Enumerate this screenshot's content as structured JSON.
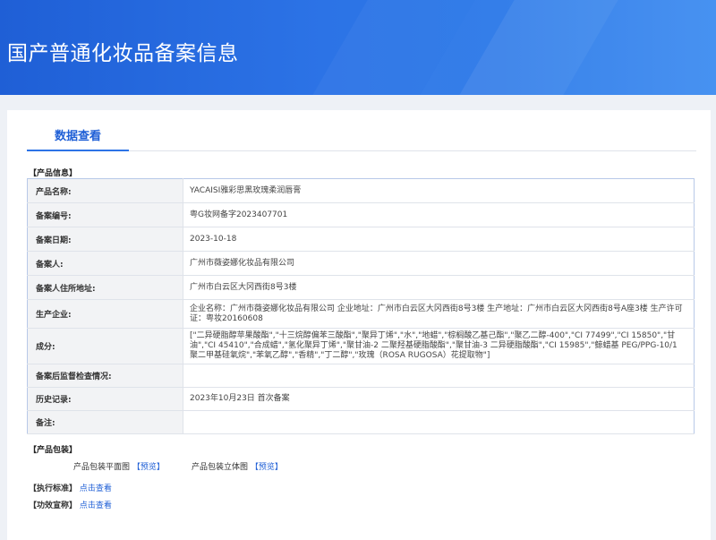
{
  "banner": {
    "title": "国产普通化妆品备案信息"
  },
  "tab": {
    "label": "数据查看"
  },
  "product_info": {
    "section": "【产品信息】",
    "rows": [
      {
        "key": "产品名称:",
        "value": "YACAISI雅彩思黑玫瑰柔润唇膏"
      },
      {
        "key": "备案编号:",
        "value": "粤G妆网备字2023407701"
      },
      {
        "key": "备案日期:",
        "value": "2023-10-18"
      },
      {
        "key": "备案人:",
        "value": "广州市薇姿娜化妆品有限公司"
      },
      {
        "key": "备案人住所地址:",
        "value": "广州市白云区大冈西街8号3楼"
      },
      {
        "key": "生产企业:",
        "value": "企业名称：广州市薇姿娜化妆品有限公司 企业地址：广州市白云区大冈西街8号3楼 生产地址：广州市白云区大冈西街8号A座3楼 生产许可证：粤妆20160608"
      },
      {
        "key": "成分:",
        "value": "[\"二异硬脂醇苹果酸酯\",\"十三烷醇偏苯三酸酯\",\"聚异丁烯\",\"水\",\"地蜡\",\"棕榈酸乙基己酯\",\"聚乙二醇-400\",\"CI 77499\",\"CI 15850\",\"甘油\",\"CI 45410\",\"合成蜡\",\"氢化聚异丁烯\",\"聚甘油-2 二聚羟基硬脂酸酯\",\"聚甘油-3 二异硬脂酸酯\",\"CI 15985\",\"鲸蜡基 PEG/PPG-10/1 聚二甲基硅氧烷\",\"苯氧乙醇\",\"香精\",\"丁二醇\",\"玫瑰（ROSA RUGOSA）花提取物\"]"
      },
      {
        "key": "备案后监督检查情况:",
        "value": ""
      },
      {
        "key": "历史记录:",
        "value": "2023年10月23日 首次备案"
      },
      {
        "key": "备注:",
        "value": ""
      }
    ]
  },
  "packaging": {
    "section": "【产品包装】",
    "flat_label": "产品包装平面图",
    "flat_link": "【预览】",
    "solid_label": "产品包装立体图",
    "solid_link": "【预览】"
  },
  "standard": {
    "section": "【执行标准】",
    "link": "点击查看"
  },
  "efficacy": {
    "section": "【功效宣称】",
    "link": "点击查看"
  },
  "colors": {
    "banner": "#2c73e6",
    "accent": "#1f5fd6",
    "key_bg": "#f2f3f5",
    "table_border": "#b8c9e8"
  }
}
